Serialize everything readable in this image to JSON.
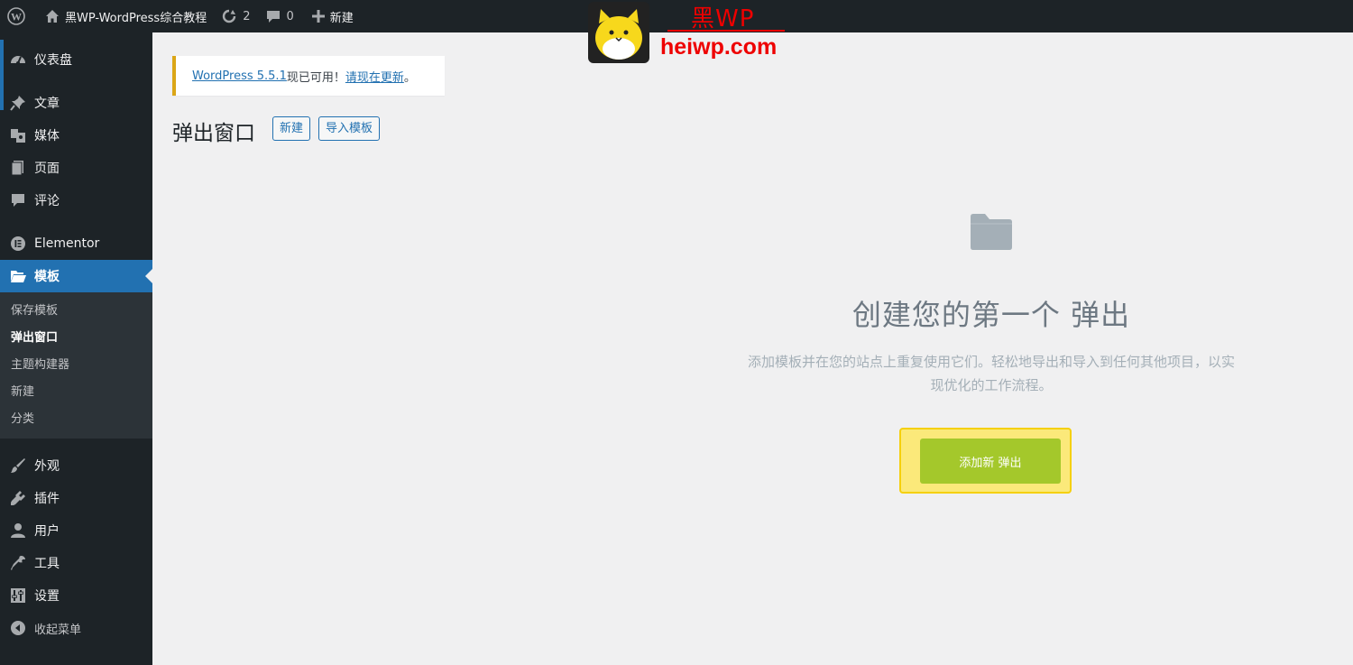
{
  "adminbar": {
    "wp_logo_icon": "wordpress-icon",
    "site_icon": "home-icon",
    "site_name": "黑WP-WordPress综合教程",
    "updates_icon": "updates-icon",
    "updates_count": "2",
    "comments_icon": "comment-icon",
    "comments_count": "0",
    "new_icon": "plus-icon",
    "new_label": "新建"
  },
  "sidebar": {
    "items": [
      {
        "label": "仪表盘",
        "icon": "dashboard-icon"
      },
      {
        "label": "文章",
        "icon": "pin-icon"
      },
      {
        "label": "媒体",
        "icon": "media-icon"
      },
      {
        "label": "页面",
        "icon": "page-icon"
      },
      {
        "label": "评论",
        "icon": "comment-icon"
      },
      {
        "label": "Elementor",
        "icon": "elementor-icon"
      },
      {
        "label": "模板",
        "icon": "folder-open-icon"
      },
      {
        "label": "外观",
        "icon": "brush-icon"
      },
      {
        "label": "插件",
        "icon": "plugin-icon"
      },
      {
        "label": "用户",
        "icon": "user-icon"
      },
      {
        "label": "工具",
        "icon": "wrench-icon"
      },
      {
        "label": "设置",
        "icon": "settings-icon"
      },
      {
        "label": "收起菜单",
        "icon": "collapse-icon"
      }
    ],
    "submenu": [
      "保存模板",
      "弹出窗口",
      "主题构建器",
      "新建",
      "分类"
    ]
  },
  "notice": {
    "link_text": "WordPress 5.5.1",
    "middle_text": "现已可用！",
    "action_link": "请现在更新",
    "end_text": "。"
  },
  "page": {
    "title": "弹出窗口",
    "new_button": "新建",
    "import_button": "导入模板"
  },
  "empty_state": {
    "icon": "folder-icon",
    "title": "创建您的第一个 弹出",
    "description": "添加模板并在您的站点上重复使用它们。轻松地导出和导入到任何其他项目，以实现优化的工作流程。",
    "button": "添加新 弹出"
  },
  "watermark": {
    "cn_text": "黑WP",
    "url": "heiwp.com"
  },
  "colors": {
    "admin_dark": "#1d2327",
    "accent_blue": "#2271b1",
    "notice_yellow": "#dba617",
    "add_button_green": "#a4c82b",
    "highlight_yellow": "#fbe97a",
    "watermark_red": "#e00000"
  }
}
